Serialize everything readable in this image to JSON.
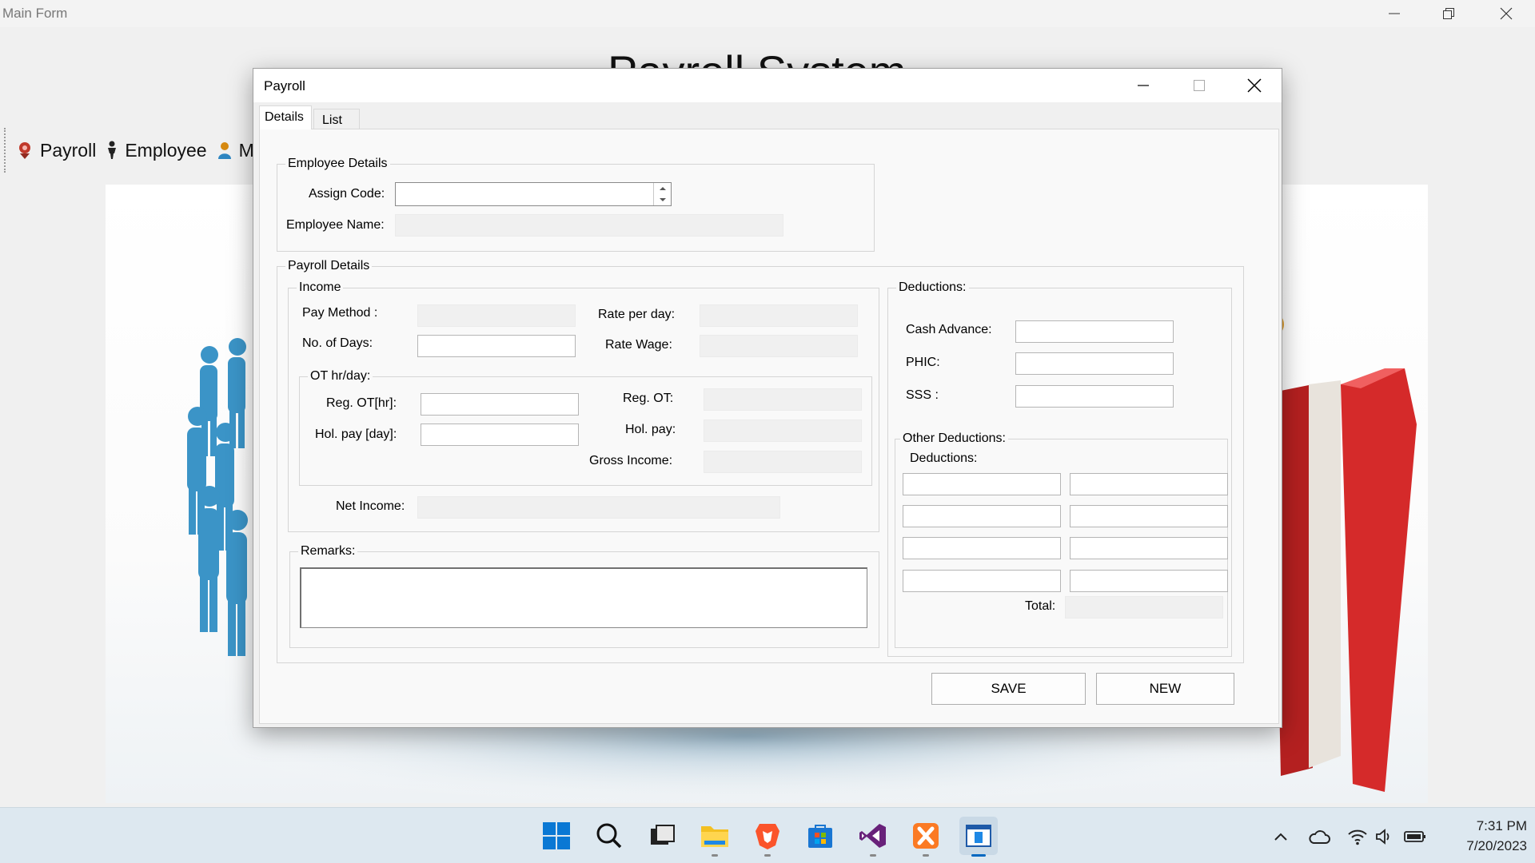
{
  "main_window": {
    "title": "Main Form",
    "background_title": "Payroll System",
    "toolbar": {
      "items": [
        {
          "label": "Payroll",
          "icon": "payroll-icon"
        },
        {
          "label": "Employee",
          "icon": "employee-icon"
        },
        {
          "label": "M",
          "icon": "user-icon"
        }
      ]
    }
  },
  "dialog": {
    "title": "Payroll",
    "tabs": [
      {
        "label": "Details",
        "active": true
      },
      {
        "label": "List",
        "active": false
      }
    ],
    "employee_details": {
      "legend": "Employee Details",
      "assign_code_label": "Assign Code:",
      "assign_code_value": "",
      "employee_name_label": "Employee Name:",
      "employee_name_value": ""
    },
    "payroll_details": {
      "legend": "Payroll Details",
      "income": {
        "legend": "Income",
        "pay_method_label": "Pay Method  :",
        "no_of_days_label": "No. of Days:",
        "rate_per_day_label": "Rate per day:",
        "rate_wage_label": "Rate Wage:"
      },
      "ot": {
        "legend": "OT hr/day:",
        "reg_ot_hr_label": "Reg. OT[hr]:",
        "hol_pay_day_label": "Hol. pay [day]:",
        "reg_ot_label": "Reg. OT:",
        "hol_pay_label": "Hol. pay:",
        "gross_income_label": "Gross Income:"
      },
      "net_income_label": "Net Income:",
      "remarks_legend": "Remarks:",
      "deductions": {
        "legend": "Deductions:",
        "cash_advance_label": "Cash Advance:",
        "phic_label": "PHIC:",
        "sss_label": "SSS :",
        "other_legend": "Other Deductions:",
        "other_sub_label": "Deductions:",
        "total_label": "Total:"
      }
    },
    "buttons": {
      "save": "SAVE",
      "new": "NEW"
    }
  },
  "taskbar": {
    "apps": [
      "windows-start-icon",
      "search-icon",
      "task-view-icon",
      "file-explorer-icon",
      "brave-browser-icon",
      "microsoft-store-icon",
      "visual-studio-icon",
      "xampp-icon",
      "payroll-app-icon"
    ],
    "clock_time": "7:31 PM",
    "clock_date": "7/20/2023"
  },
  "colors": {
    "accent": "#0067c0",
    "dialog_bg": "#f0f0f0",
    "taskbar_bg": "#dde8f0"
  }
}
